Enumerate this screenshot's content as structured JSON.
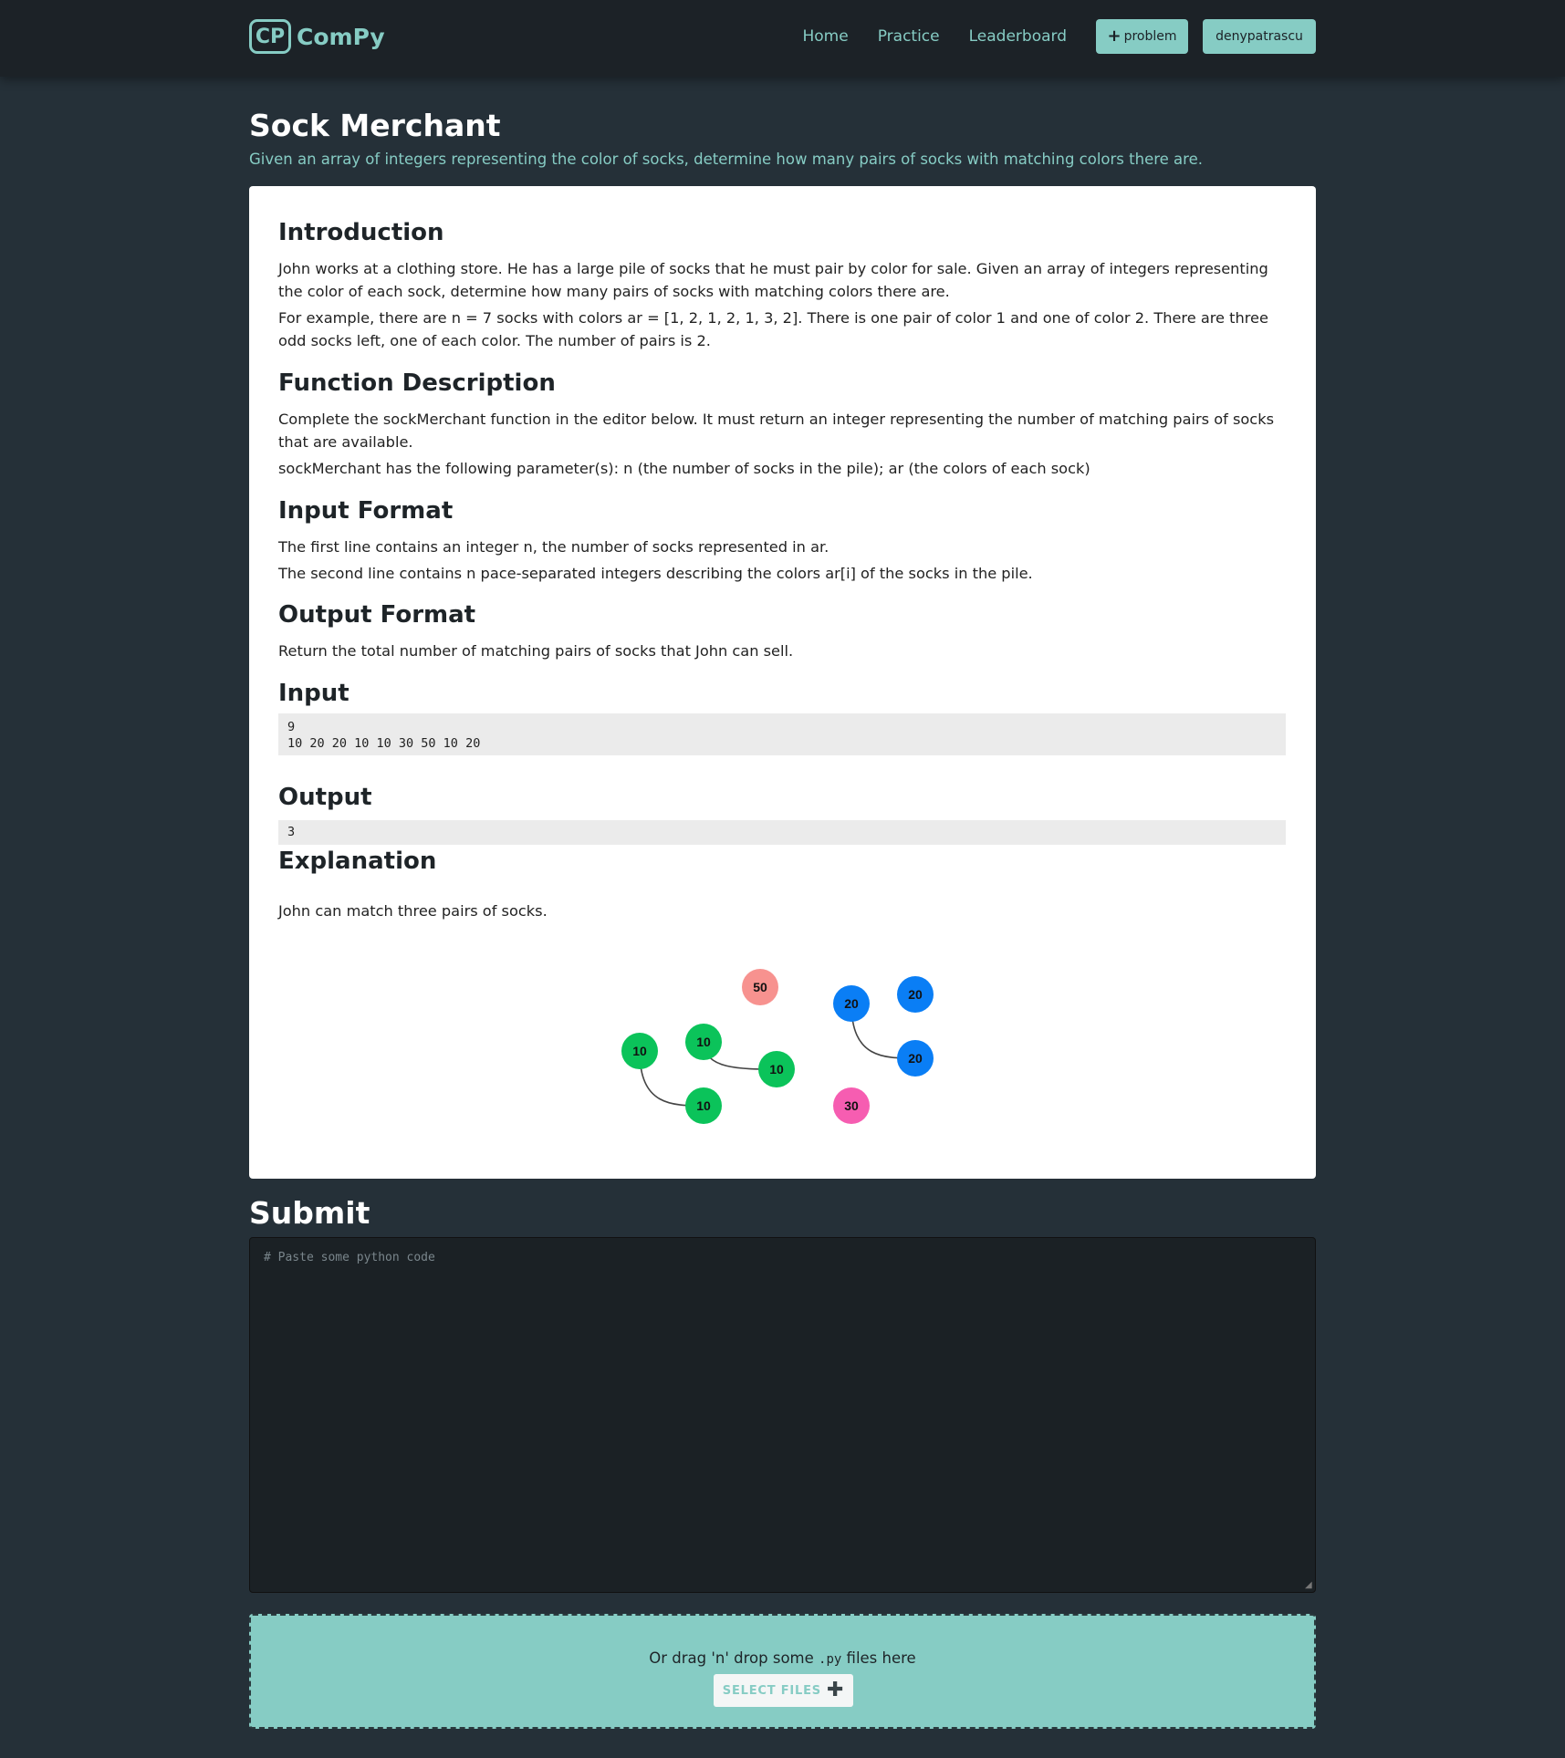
{
  "nav": {
    "logo_text": "CP",
    "brand": "ComPy",
    "links": [
      "Home",
      "Practice",
      "Leaderboard"
    ],
    "problem_button": "problem",
    "user_button": "denypatrascu"
  },
  "header": {
    "title": "Sock Merchant",
    "subtitle": "Given an array of integers representing the color of socks, determine how many pairs of socks with matching colors there are."
  },
  "problem": {
    "introduction_heading": "Introduction",
    "introduction_p1": "John works at a clothing store. He has a large pile of socks that he must pair by color for sale. Given an array of integers representing the color of each sock, determine how many pairs of socks with matching colors there are.",
    "introduction_p2": "For example, there are n = 7 socks with colors ar = [1, 2, 1, 2, 1, 3, 2]. There is one pair of color 1 and one of color 2. There are three odd socks left, one of each color. The number of pairs is 2.",
    "function_heading": "Function Description",
    "function_p1": "Complete the sockMerchant function in the editor below. It must return an integer representing the number of matching pairs of socks that are available.",
    "function_p2": "sockMerchant has the following parameter(s): n (the number of socks in the pile); ar (the colors of each sock)",
    "input_format_heading": "Input Format",
    "input_format_p1": "The first line contains an integer n, the number of socks represented in ar.",
    "input_format_p2": "The second line contains n pace-separated integers describing the colors ar[i] of the socks in the pile.",
    "output_format_heading": "Output Format",
    "output_format_p1": "Return the total number of matching pairs of socks that John can sell.",
    "input_heading": "Input",
    "input_line1": "9",
    "input_line2": "10 20 20 10 10 30 50 10 20",
    "output_heading": "Output",
    "output_value": "3",
    "explanation_heading": "Explanation",
    "explanation_p1": "John can match three pairs of socks."
  },
  "diagram": {
    "nodes": [
      {
        "label": "50",
        "color": "#f7928f"
      },
      {
        "label": "20",
        "color": "#0a7ef5"
      },
      {
        "label": "20",
        "color": "#0a7ef5"
      },
      {
        "label": "10",
        "color": "#0bc35a"
      },
      {
        "label": "10",
        "color": "#0bc35a"
      },
      {
        "label": "10",
        "color": "#0bc35a"
      },
      {
        "label": "20",
        "color": "#0a7ef5"
      },
      {
        "label": "10",
        "color": "#0bc35a"
      },
      {
        "label": "30",
        "color": "#f65db1"
      }
    ],
    "pairs": [
      [
        3,
        7
      ],
      [
        4,
        5
      ],
      [
        1,
        6
      ]
    ]
  },
  "submit": {
    "title": "Submit",
    "editor_placeholder": "# Paste some python code",
    "drop_text_before": "Or drag 'n' drop some ",
    "drop_ext": ".py",
    "drop_text_after": " files here",
    "select_button": "SELECT FILES"
  },
  "colors": {
    "accent": "#86ccc4",
    "page_bg": "#253038",
    "navbar_bg": "#1c2227"
  }
}
